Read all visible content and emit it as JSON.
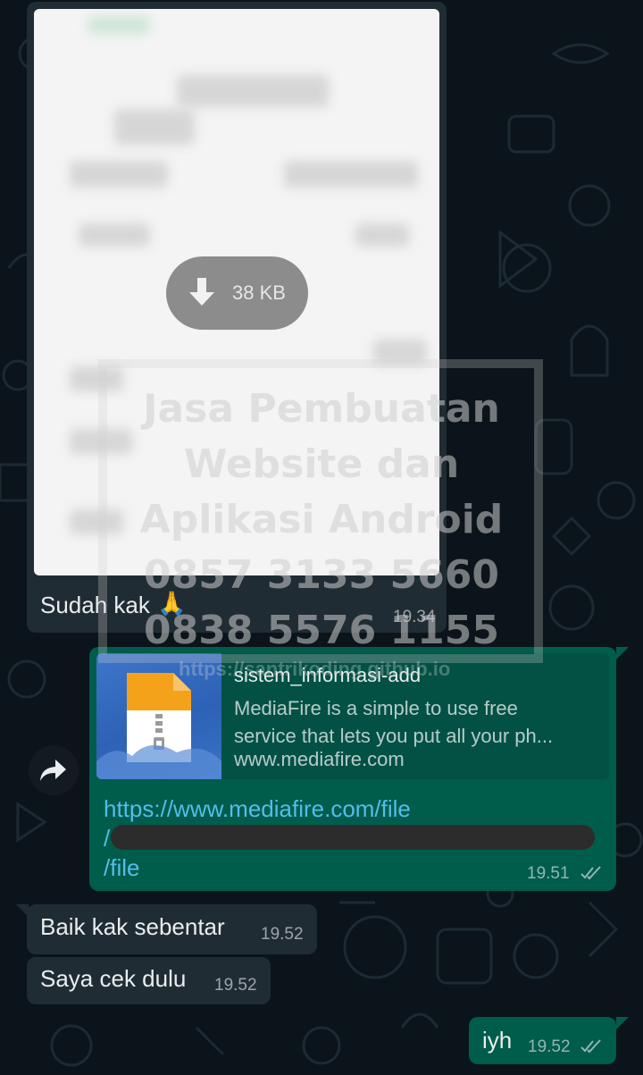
{
  "chat": {
    "image_message": {
      "download_size": "38 KB",
      "caption": "Sudah kak",
      "caption_emoji": "🙏",
      "time": "19.34"
    },
    "link_message": {
      "preview_title": "sistem_informasi-add",
      "preview_desc_line1": "MediaFire is a simple to use free",
      "preview_desc_line2": "service that lets you put all your ph...",
      "preview_domain": "www.mediafire.com",
      "url_line1": "https://www.mediafire.com/file",
      "url_line2": "/",
      "url_line3": "/file",
      "time": "19.51",
      "status": "read"
    },
    "messages": [
      {
        "text": "Baik kak sebentar",
        "time": "19.52",
        "direction": "in"
      },
      {
        "text": "Saya cek dulu",
        "time": "19.52",
        "direction": "in"
      },
      {
        "text": "iyh",
        "time": "19.52",
        "direction": "out",
        "status": "read"
      }
    ]
  },
  "watermark": {
    "line1": "Jasa Pembuatan",
    "line2": "Website dan",
    "line3": "Aplikasi Android",
    "line4": "0857 3133 5660",
    "line5": "0838 5576 1155",
    "url": "https://santrikoding.github.io"
  },
  "colors": {
    "background": "#0b141a",
    "incoming_bubble": "#202c33",
    "outgoing_bubble": "#005c4b",
    "link": "#53bdeb"
  }
}
